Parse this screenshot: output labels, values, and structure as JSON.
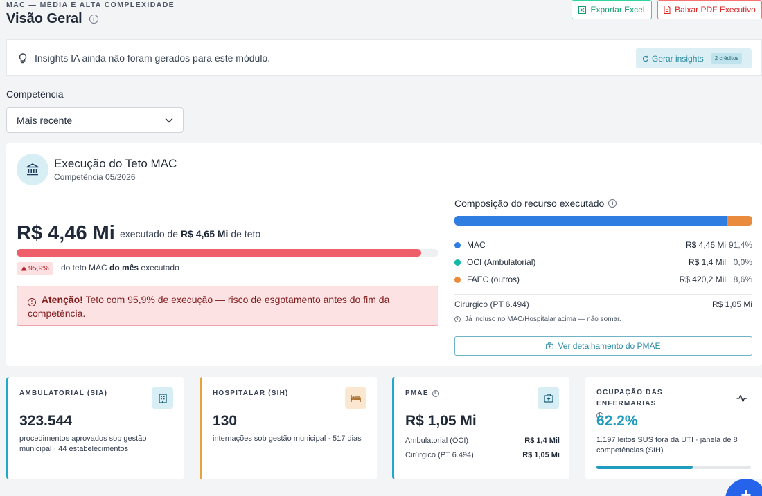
{
  "header": {
    "eyebrow": "MAC — MÉDIA E ALTA COMPLEXIDADE",
    "title": "Visão Geral",
    "export_excel": "Exportar Excel",
    "export_pdf": "Baixar PDF Executivo"
  },
  "insights": {
    "message": "Insights IA ainda não foram gerados para este módulo.",
    "button_label": "Gerar insights",
    "credits": "2 créditos"
  },
  "filters": {
    "competencia_label": "Competência",
    "competencia_value": "Mais recente"
  },
  "teto": {
    "title": "Execução do Teto MAC",
    "subtitle": "Competência 05/2026",
    "executed_value": "R$ 4,46 Mi",
    "executed_prefix": "executado de",
    "ceiling_value": "R$ 4,65 Mi",
    "ceiling_suffix": "de teto",
    "progress_fraction": 0.959,
    "percent_badge": "95,9%",
    "percent_note_prefix": "do teto MAC",
    "percent_note_bold": "do mês",
    "percent_note_suffix": "executado",
    "alert_title": "Atenção!",
    "alert_text": "Teto com 95,9% de execução — risco de esgotamento antes do fim da competência."
  },
  "composition": {
    "title": "Composição do recurso executado",
    "items": [
      {
        "name": "MAC",
        "value": "R$ 4,46 Mi",
        "percent": "91,4%",
        "share": 0.914,
        "color": "#2f7de1"
      },
      {
        "name": "OCI (Ambulatorial)",
        "value": "R$ 1,4 Mil",
        "percent": "0,0%",
        "share": 0.0,
        "color": "#14b8a6"
      },
      {
        "name": "FAEC (outros)",
        "value": "R$ 420,2 Mil",
        "percent": "8,6%",
        "share": 0.086,
        "color": "#ea8a3c"
      }
    ],
    "cirurgico_label": "Cirúrgico (PT 6.494)",
    "cirurgico_value": "R$ 1,05 Mi",
    "note": "Já incluso no MAC/Hospitalar acima — não somar.",
    "pmae_button": "Ver detalhamento do PMAE"
  },
  "kpis": {
    "ambulatorial": {
      "label": "AMBULATORIAL (SIA)",
      "value": "323.544",
      "desc": "procedimentos aprovados sob gestão municipal · 44 estabelecimentos",
      "icon": "building-icon",
      "accent": "#22a9c9"
    },
    "hospitalar": {
      "label": "HOSPITALAR (SIH)",
      "value": "130",
      "desc": "internações sob gestão municipal · 517 dias",
      "icon": "bed-icon",
      "accent": "#e8a23a"
    },
    "pmae": {
      "label": "PMAE",
      "value": "R$ 1,05 Mi",
      "rows": [
        {
          "label": "Ambulatorial (OCI)",
          "value": "R$ 1,4 Mil"
        },
        {
          "label": "Cirúrgico (PT 6.494)",
          "value": "R$ 1,05 Mi"
        }
      ],
      "icon": "medical-kit-icon",
      "accent": "#22a9c9"
    },
    "ocupacao": {
      "label": "OCUPAÇÃO DAS ENFERMARIAS",
      "value": "62.2%",
      "occupancy_fraction": 0.622,
      "desc": "1.197 leitos SUS fora da UTI · janela de 8 competências (SIH)",
      "icon": "activity-icon",
      "accent": "#1f9cc0"
    }
  },
  "fab": {
    "label": "+"
  }
}
